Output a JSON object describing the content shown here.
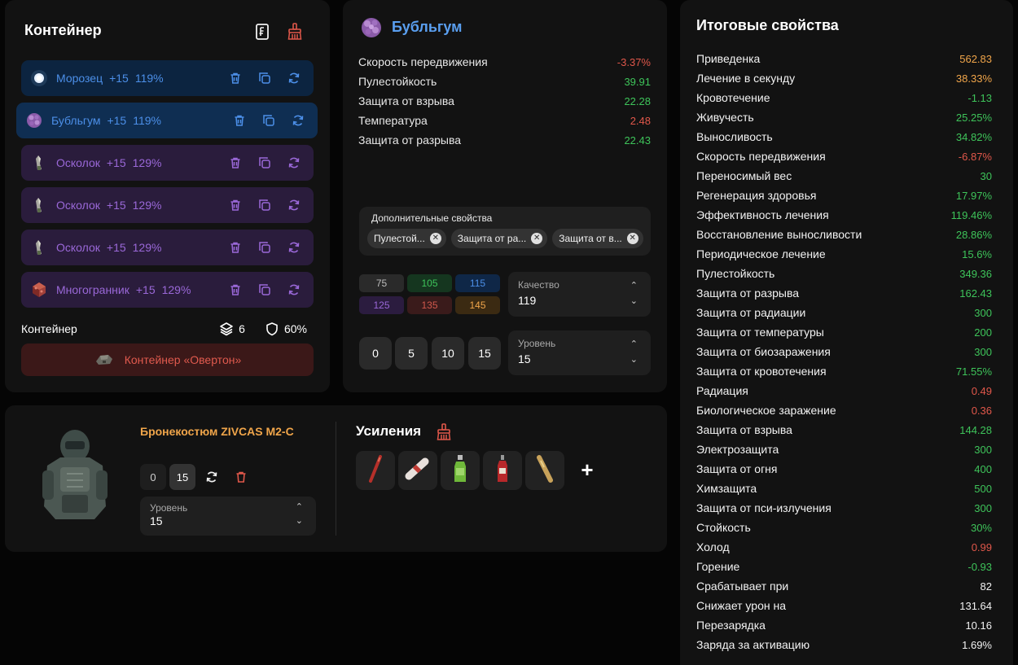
{
  "container": {
    "title": "Контейнер",
    "footer_label": "Контейнер",
    "slots_count": "6",
    "protection": "60%",
    "container_button": "Контейнер «Овертон»",
    "slots": [
      {
        "name": "Морозец",
        "upgrade": "+15",
        "quality": "119%",
        "color": "blue",
        "icon": "frost-orb-icon"
      },
      {
        "name": "Бубльгум",
        "upgrade": "+15",
        "quality": "119%",
        "color": "blue",
        "icon": "bubblegum-icon",
        "selected": true
      },
      {
        "name": "Осколок",
        "upgrade": "+15",
        "quality": "129%",
        "color": "purple",
        "icon": "shard-icon"
      },
      {
        "name": "Осколок",
        "upgrade": "+15",
        "quality": "129%",
        "color": "purple",
        "icon": "shard-icon"
      },
      {
        "name": "Осколок",
        "upgrade": "+15",
        "quality": "129%",
        "color": "purple",
        "icon": "shard-icon"
      },
      {
        "name": "Многогранник",
        "upgrade": "+15",
        "quality": "129%",
        "color": "purple",
        "icon": "polyhedron-icon"
      }
    ]
  },
  "artifact": {
    "title": "Бубльгум",
    "props": [
      {
        "name": "Скорость передвижения",
        "value": "-3.37%",
        "color": "#e0574a"
      },
      {
        "name": "Пулестойкость",
        "value": "39.91",
        "color": "#3ec45a"
      },
      {
        "name": "Защита от взрыва",
        "value": "22.28",
        "color": "#3ec45a"
      },
      {
        "name": "Температура",
        "value": "2.48",
        "color": "#e0574a"
      },
      {
        "name": "Защита от разрыва",
        "value": "22.43",
        "color": "#3ec45a"
      }
    ],
    "extra_label": "Дополнительные свойства",
    "extra_chips": [
      "Пулестой...",
      "Защита от ра...",
      "Защита от в..."
    ],
    "quality_options": [
      {
        "value": "75",
        "bg": "#2a2a2a",
        "fg": "#bdbdbd"
      },
      {
        "value": "105",
        "bg": "#15361f",
        "fg": "#3ec45a"
      },
      {
        "value": "115",
        "bg": "#0f2747",
        "fg": "#4c8fe8"
      },
      {
        "value": "125",
        "bg": "#2b1c3f",
        "fg": "#9a68d8"
      },
      {
        "value": "135",
        "bg": "#3a1b1b",
        "fg": "#d0584c"
      },
      {
        "value": "145",
        "bg": "#3b2a12",
        "fg": "#f0a54a"
      }
    ],
    "quality_label": "Качество",
    "quality_value": "119",
    "level_buttons": [
      "0",
      "5",
      "10",
      "15"
    ],
    "level_label": "Уровень",
    "level_value": "15"
  },
  "armor": {
    "name": "Бронекостюм ZIVCAS M2-C",
    "level_0": "0",
    "level_15": "15",
    "level_label": "Уровень",
    "level_value": "15",
    "boosts_title": "Усиления",
    "add_label": "+"
  },
  "totals": {
    "title": "Итоговые свойства",
    "rows": [
      {
        "name": "Приведенка",
        "value": "562.83",
        "color": "#f0a54a"
      },
      {
        "name": "Лечение в секунду",
        "value": "38.33%",
        "color": "#f0a54a"
      },
      {
        "name": "Кровотечение",
        "value": "-1.13",
        "color": "#3ec45a"
      },
      {
        "name": "Живучесть",
        "value": "25.25%",
        "color": "#3ec45a"
      },
      {
        "name": "Выносливость",
        "value": "34.82%",
        "color": "#3ec45a"
      },
      {
        "name": "Скорость передвижения",
        "value": "-6.87%",
        "color": "#e0574a"
      },
      {
        "name": "Переносимый вес",
        "value": "30",
        "color": "#3ec45a"
      },
      {
        "name": "Регенерация здоровья",
        "value": "17.97%",
        "color": "#3ec45a"
      },
      {
        "name": "Эффективность лечения",
        "value": "119.46%",
        "color": "#3ec45a"
      },
      {
        "name": "Восстановление выносливости",
        "value": "28.86%",
        "color": "#3ec45a"
      },
      {
        "name": "Периодическое лечение",
        "value": "15.6%",
        "color": "#3ec45a"
      },
      {
        "name": "Пулестойкость",
        "value": "349.36",
        "color": "#3ec45a"
      },
      {
        "name": "Защита от разрыва",
        "value": "162.43",
        "color": "#3ec45a"
      },
      {
        "name": "Защита от радиации",
        "value": "300",
        "color": "#3ec45a"
      },
      {
        "name": "Защита от температуры",
        "value": "200",
        "color": "#3ec45a"
      },
      {
        "name": "Защита от биозаражения",
        "value": "300",
        "color": "#3ec45a"
      },
      {
        "name": "Защита от кровотечения",
        "value": "71.55%",
        "color": "#3ec45a"
      },
      {
        "name": "Радиация",
        "value": "0.49",
        "color": "#e0574a"
      },
      {
        "name": "Биологическое заражение",
        "value": "0.36",
        "color": "#e0574a"
      },
      {
        "name": "Защита от взрыва",
        "value": "144.28",
        "color": "#3ec45a"
      },
      {
        "name": "Электрозащита",
        "value": "300",
        "color": "#3ec45a"
      },
      {
        "name": "Защита от огня",
        "value": "400",
        "color": "#3ec45a"
      },
      {
        "name": "Химзащита",
        "value": "500",
        "color": "#3ec45a"
      },
      {
        "name": "Защита от пси-излучения",
        "value": "300",
        "color": "#3ec45a"
      },
      {
        "name": "Стойкость",
        "value": "30%",
        "color": "#3ec45a"
      },
      {
        "name": "Холод",
        "value": "0.99",
        "color": "#e0574a"
      },
      {
        "name": "Горение",
        "value": "-0.93",
        "color": "#3ec45a"
      },
      {
        "name": "Срабатывает при",
        "value": "82",
        "color": "#f2f2f2"
      },
      {
        "name": "Снижает урон на",
        "value": "131.64",
        "color": "#f2f2f2"
      },
      {
        "name": "Перезарядка",
        "value": "10.16",
        "color": "#f2f2f2"
      },
      {
        "name": "Заряда за активацию",
        "value": "1.69%",
        "color": "#f2f2f2"
      }
    ]
  }
}
